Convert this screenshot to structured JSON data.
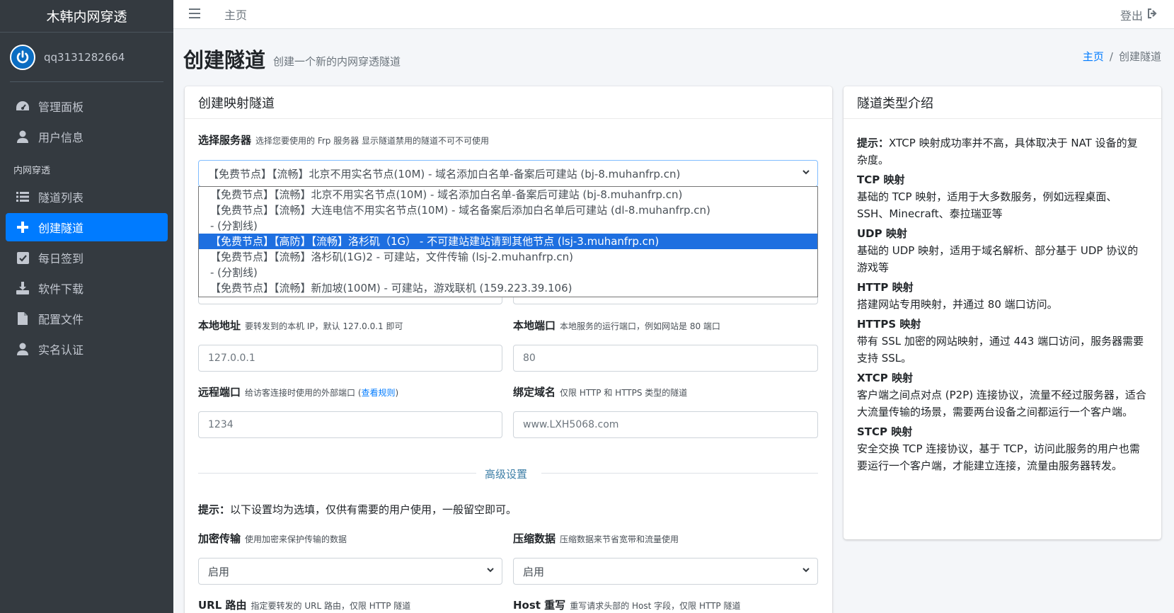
{
  "brand": "木韩内网穿透",
  "user": {
    "name": "qq3131282664"
  },
  "sidebar": {
    "items": [
      {
        "label": "管理面板",
        "icon": "dashboard-icon"
      },
      {
        "label": "用户信息",
        "icon": "user-icon"
      }
    ],
    "section_header": "内网穿透",
    "items2": [
      {
        "label": "隧道列表",
        "icon": "list-icon"
      },
      {
        "label": "创建隧道",
        "icon": "plus-icon",
        "active": true
      },
      {
        "label": "每日签到",
        "icon": "check-square-icon"
      },
      {
        "label": "软件下载",
        "icon": "download-icon"
      },
      {
        "label": "配置文件",
        "icon": "file-icon"
      },
      {
        "label": "实名认证",
        "icon": "user-icon"
      }
    ]
  },
  "topbar": {
    "home": "主页",
    "logout": "登出"
  },
  "header": {
    "title": "创建隧道",
    "subtitle": "创建一个新的内网穿透隧道"
  },
  "breadcrumb": {
    "home": "主页",
    "sep": "/",
    "current": "创建隧道"
  },
  "form": {
    "card_title": "创建映射隧道",
    "server": {
      "label": "选择服务器",
      "hint": "选择您要使用的 Frp 服务器 显示隧道禁用的隧道不可不可使用",
      "selected": "【免费节点】【流畅】北京不用实名节点(10M) - 域名添加白名单-备案后可建站 (bj-8.muhanfrp.cn)",
      "options": [
        "【免费节点】【流畅】北京不用实名节点(10M) - 域名添加白名单-备案后可建站 (bj-8.muhanfrp.cn)",
        "【免费节点】【流畅】大连电信不用实名节点(10M) - 域名备案后添加白名单后可建站 (dl-8.muhanfrp.cn)",
        "- (分割线)",
        "【免费节点】【高防】【流畅】洛杉矶（1G） - 不可建站建站请到其他节点 (lsj-3.muhanfrp.cn)",
        "【免费节点】【流畅】洛杉矶(1G)2 - 可建站，文件传输 (lsj-2.muhanfrp.cn)",
        "- (分割线)",
        "【免费节点】【流畅】新加坡(100M) - 可建站，游戏联机 (159.223.39.106)"
      ],
      "selected_index": 3
    },
    "local_ip": {
      "label": "本地地址",
      "hint": "要转发到的本机 IP，默认 127.0.0.1 即可",
      "placeholder": "127.0.0.1"
    },
    "local_port": {
      "label": "本地端口",
      "hint": "本地服务的运行端口，例如网站是 80 端口",
      "placeholder": "80"
    },
    "remote_port": {
      "label": "远程端口",
      "hint_pre": "给访客连接时使用的外部端口 (",
      "hint_link": "查看规则",
      "hint_post": ")",
      "placeholder": "1234"
    },
    "domain": {
      "label": "绑定域名",
      "hint": "仅限 HTTP 和 HTTPS 类型的隧道",
      "placeholder": "www.LXH5068.com"
    },
    "advanced_title": "高级设置",
    "tip_label": "提示：",
    "tip_text": "以下设置均为选填，仅供有需要的用户使用，一般留空即可。",
    "encrypt": {
      "label": "加密传输",
      "hint": "使用加密来保护传输的数据",
      "value": "启用"
    },
    "compress": {
      "label": "压缩数据",
      "hint": "压缩数据来节省宽带和流量使用",
      "value": "启用"
    },
    "url_route": {
      "label": "URL 路由",
      "hint": "指定要转发的 URL 路由，仅限 HTTP 隧道"
    },
    "host_rewrite": {
      "label": "Host 重写",
      "hint": "重写请求头部的 Host 字段，仅限 HTTP 隧道"
    }
  },
  "info": {
    "card_title": "隧道类型介绍",
    "tip_label": "提示：",
    "tip_text": "XTCP 映射成功率并不高，具体取决于 NAT 设备的复杂度。",
    "types": [
      {
        "name": "TCP 映射",
        "desc": "基础的 TCP 映射，适用于大多数服务，例如远程桌面、SSH、Minecraft、泰拉瑞亚等"
      },
      {
        "name": "UDP 映射",
        "desc": "基础的 UDP 映射，适用于域名解析、部分基于 UDP 协议的游戏等"
      },
      {
        "name": "HTTP 映射",
        "desc": "搭建网站专用映射，并通过 80 端口访问。"
      },
      {
        "name": "HTTPS 映射",
        "desc": "带有 SSL 加密的网站映射，通过 443 端口访问，服务器需要支持 SSL。"
      },
      {
        "name": "XTCP 映射",
        "desc": "客户端之间点对点 (P2P) 连接协议，流量不经过服务器，适合大流量传输的场景，需要两台设备之间都运行一个客户端。"
      },
      {
        "name": "STCP 映射",
        "desc": "安全交换 TCP 连接协议，基于 TCP，访问此服务的用户也需要运行一个客户端，才能建立连接，流量由服务器转发。"
      }
    ]
  }
}
